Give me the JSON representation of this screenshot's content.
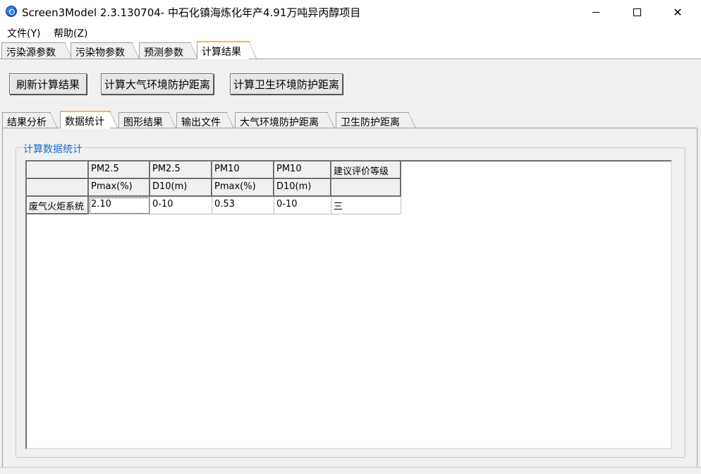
{
  "window": {
    "title": "Screen3Model 2.3.130704- 中石化镇海炼化年产4.91万吨异丙醇项目",
    "minimize_glyph": "",
    "maximize_glyph": "",
    "close_glyph": "✕"
  },
  "menu": {
    "file": "文件(Y)",
    "help": "帮助(Z)"
  },
  "outer_tabs": [
    {
      "label": "污染源参数"
    },
    {
      "label": "污染物参数"
    },
    {
      "label": "预测参数"
    },
    {
      "label": "计算结果"
    }
  ],
  "buttons": {
    "refresh": "刷新计算结果",
    "air_distance": "计算大气环境防护距离",
    "health_distance": "计算卫生环境防护距离"
  },
  "inner_tabs": [
    {
      "label": "结果分析"
    },
    {
      "label": "数据统计"
    },
    {
      "label": "图形结果"
    },
    {
      "label": "输出文件"
    },
    {
      "label": "大气环境防护距离"
    },
    {
      "label": "卫生防护距离"
    }
  ],
  "group": {
    "title": "计算数据统计"
  },
  "table": {
    "header_row1": [
      "",
      "PM2.5",
      "PM2.5",
      "PM10",
      "PM10",
      "建议评价等级"
    ],
    "header_row2": [
      "",
      "Pmax(%)",
      "D10(m)",
      "Pmax(%)",
      "D10(m)",
      ""
    ],
    "rows": [
      {
        "name": "废气火炬系统",
        "cells": [
          "2.10",
          "0-10",
          "0.53",
          "0-10",
          "三"
        ]
      }
    ]
  },
  "colors": {
    "active_tab_accent": "#f5b942",
    "group_title": "#1a6ec8",
    "panel_bg": "#f0f0f0"
  }
}
